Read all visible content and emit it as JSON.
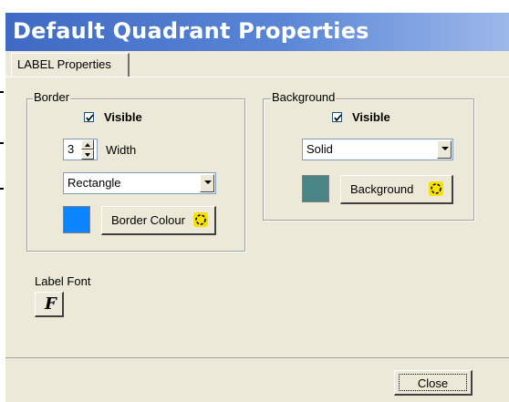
{
  "window": {
    "title": "Default Quadrant Properties"
  },
  "tabs": [
    {
      "label": "LABEL Properties"
    }
  ],
  "border": {
    "legend": "Border",
    "visible_label": "Visible",
    "visible_checked": true,
    "width_value": "3",
    "width_label": "Width",
    "shape_value": "Rectangle",
    "colour_swatch": "#0a84ff",
    "colour_button_label": "Border Colour"
  },
  "background": {
    "legend": "Background",
    "visible_label": "Visible",
    "visible_checked": true,
    "fill_value": "Solid",
    "colour_swatch": "#4a8585",
    "colour_button_label": "Background"
  },
  "label_font": {
    "label": "Label Font",
    "button_glyph": "F"
  },
  "footer": {
    "close_label": "Close"
  },
  "colors": {
    "titlebar": "#3f6ac4",
    "dialog_face": "#ece9d8",
    "icon_yellow": "#f5e200"
  }
}
